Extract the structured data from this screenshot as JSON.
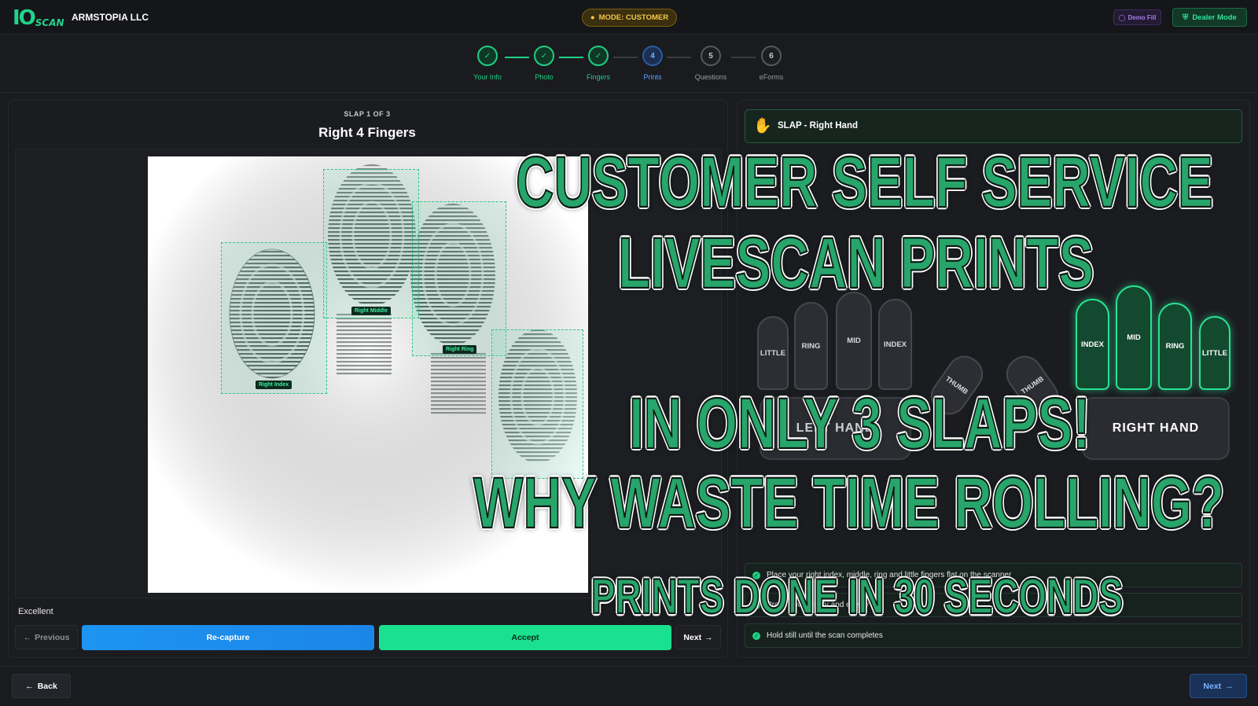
{
  "header": {
    "logo_io": "IO",
    "logo_scan": "SCAN",
    "company": "ARMSTOPIA LLC",
    "mode_label": "MODE: CUSTOMER",
    "demo_fill_label": "Demo Fill",
    "dealer_mode_label": "Dealer Mode"
  },
  "stepper": {
    "steps": [
      {
        "label": "Your Info",
        "number": "1",
        "state": "done"
      },
      {
        "label": "Photo",
        "number": "2",
        "state": "done"
      },
      {
        "label": "Fingers",
        "number": "3",
        "state": "done"
      },
      {
        "label": "Prints",
        "number": "4",
        "state": "active"
      },
      {
        "label": "Questions",
        "number": "5",
        "state": "todo"
      },
      {
        "label": "eForms",
        "number": "6",
        "state": "todo"
      }
    ]
  },
  "capture": {
    "slap_count": "SLAP 1 OF 3",
    "title": "Right 4 Fingers",
    "finger_labels": {
      "index": "Right Index",
      "middle": "Right Middle",
      "ring": "Right Ring"
    },
    "quality": "Excellent",
    "previous_label": "Previous",
    "recapture_label": "Re-capture",
    "accept_label": "Accept",
    "next_label": "Next"
  },
  "slap_panel": {
    "header": "SLAP - Right Hand",
    "left_hand": {
      "fingers": [
        "LITTLE",
        "RING",
        "MID",
        "INDEX"
      ],
      "thumb": "THUMB",
      "palm_label": "LEFT HAND"
    },
    "right_hand": {
      "fingers": [
        "INDEX",
        "MID",
        "RING",
        "LITTLE"
      ],
      "thumb": "THUMB",
      "palm_label": "RIGHT HAND"
    },
    "instructions": [
      "Place your right index, middle, ring and little fingers flat on the scanner",
      "Press down firmly and evenly",
      "Hold still until the scan completes"
    ]
  },
  "footer": {
    "back_label": "Back",
    "next_label": "Next"
  },
  "overlay": {
    "line1": "CUSTOMER SELF SERVICE",
    "line2": "LIVESCAN PRINTS",
    "line3": "IN ONLY 3 SLAPS!",
    "line4": "WHY WASTE TIME ROLLING?",
    "line5": "PRINTS DONE IN 30 SECONDS"
  },
  "colors": {
    "accent_green": "#1fcf83",
    "active_blue": "#2a5aa0",
    "overlay_green": "#27a56a",
    "mode_amber": "#f3c94b"
  }
}
